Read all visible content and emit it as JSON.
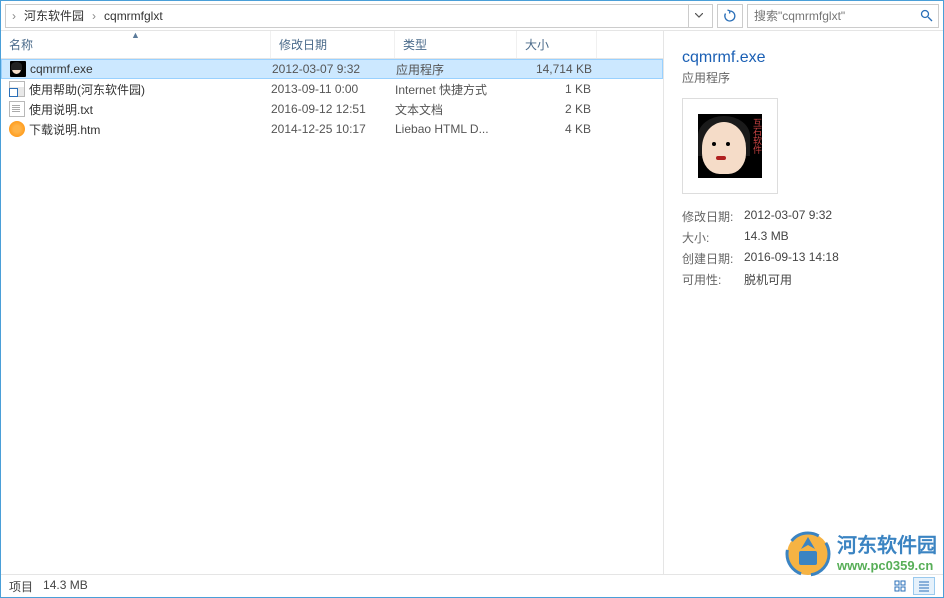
{
  "breadcrumb": {
    "items": [
      "河东软件园",
      "cqmrmfglxt"
    ]
  },
  "search": {
    "placeholder": "搜索\"cqmrmfglxt\""
  },
  "columns": {
    "name": "名称",
    "date": "修改日期",
    "type": "类型",
    "size": "大小"
  },
  "files": [
    {
      "icon": "exe",
      "name": "cqmrmf.exe",
      "date": "2012-03-07 9:32",
      "type": "应用程序",
      "size": "14,714 KB",
      "selected": true
    },
    {
      "icon": "html-shortcut",
      "name": "使用帮助(河东软件园)",
      "date": "2013-09-11 0:00",
      "type": "Internet 快捷方式",
      "size": "1 KB",
      "selected": false
    },
    {
      "icon": "txt",
      "name": "使用说明.txt",
      "date": "2016-09-12 12:51",
      "type": "文本文档",
      "size": "2 KB",
      "selected": false
    },
    {
      "icon": "htm",
      "name": "下载说明.htm",
      "date": "2014-12-25 10:17",
      "type": "Liebao HTML D...",
      "size": "4 KB",
      "selected": false
    }
  ],
  "details": {
    "title": "cqmrmf.exe",
    "subtitle": "应用程序",
    "props": [
      {
        "label": "修改日期:",
        "value": "2012-03-07 9:32"
      },
      {
        "label": "大小:",
        "value": "14.3 MB"
      },
      {
        "label": "创建日期:",
        "value": "2016-09-13 14:18"
      },
      {
        "label": "可用性:",
        "value": "脱机可用"
      }
    ]
  },
  "status": {
    "items_label": "项目",
    "size": "14.3 MB"
  },
  "watermark": {
    "title": "河东软件园",
    "url": "www.pc0359.cn"
  }
}
